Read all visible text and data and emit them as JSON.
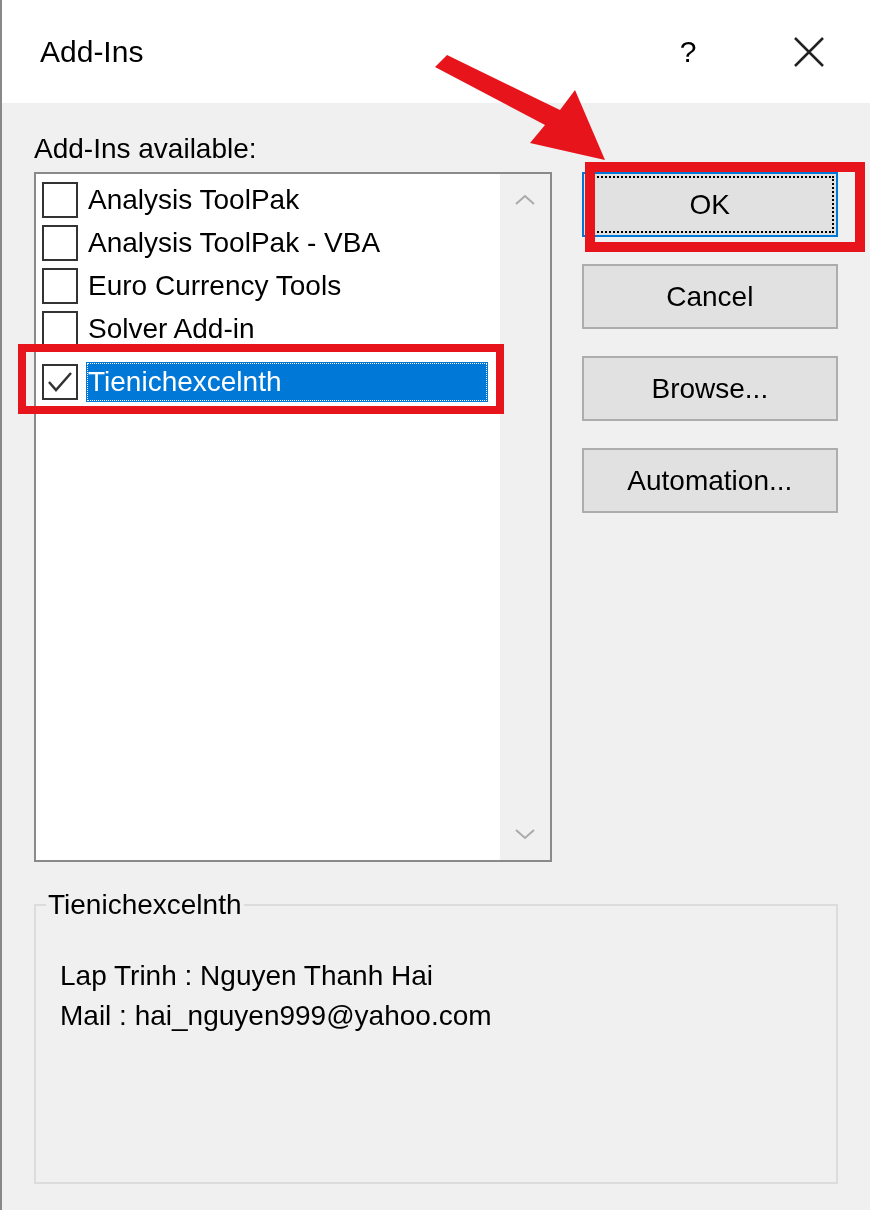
{
  "window": {
    "title": "Add-Ins",
    "help": "?"
  },
  "list": {
    "label": "Add-Ins available:",
    "items": [
      {
        "label": "Analysis ToolPak",
        "checked": false,
        "selected": false
      },
      {
        "label": "Analysis ToolPak - VBA",
        "checked": false,
        "selected": false
      },
      {
        "label": "Euro Currency Tools",
        "checked": false,
        "selected": false
      },
      {
        "label": "Solver Add-in",
        "checked": false,
        "selected": false
      },
      {
        "label": "Tienichexcelnth",
        "checked": true,
        "selected": true
      }
    ]
  },
  "buttons": [
    {
      "label": "OK",
      "focused": true
    },
    {
      "label": "Cancel",
      "focused": false
    },
    {
      "label": "Browse...",
      "focused": false
    },
    {
      "label": "Automation...",
      "focused": false
    }
  ],
  "description": {
    "title": "Tienichexcelnth",
    "lines": [
      "Lap Trinh : Nguyen Thanh Hai",
      "Mail : hai_nguyen999@yahoo.com"
    ]
  }
}
